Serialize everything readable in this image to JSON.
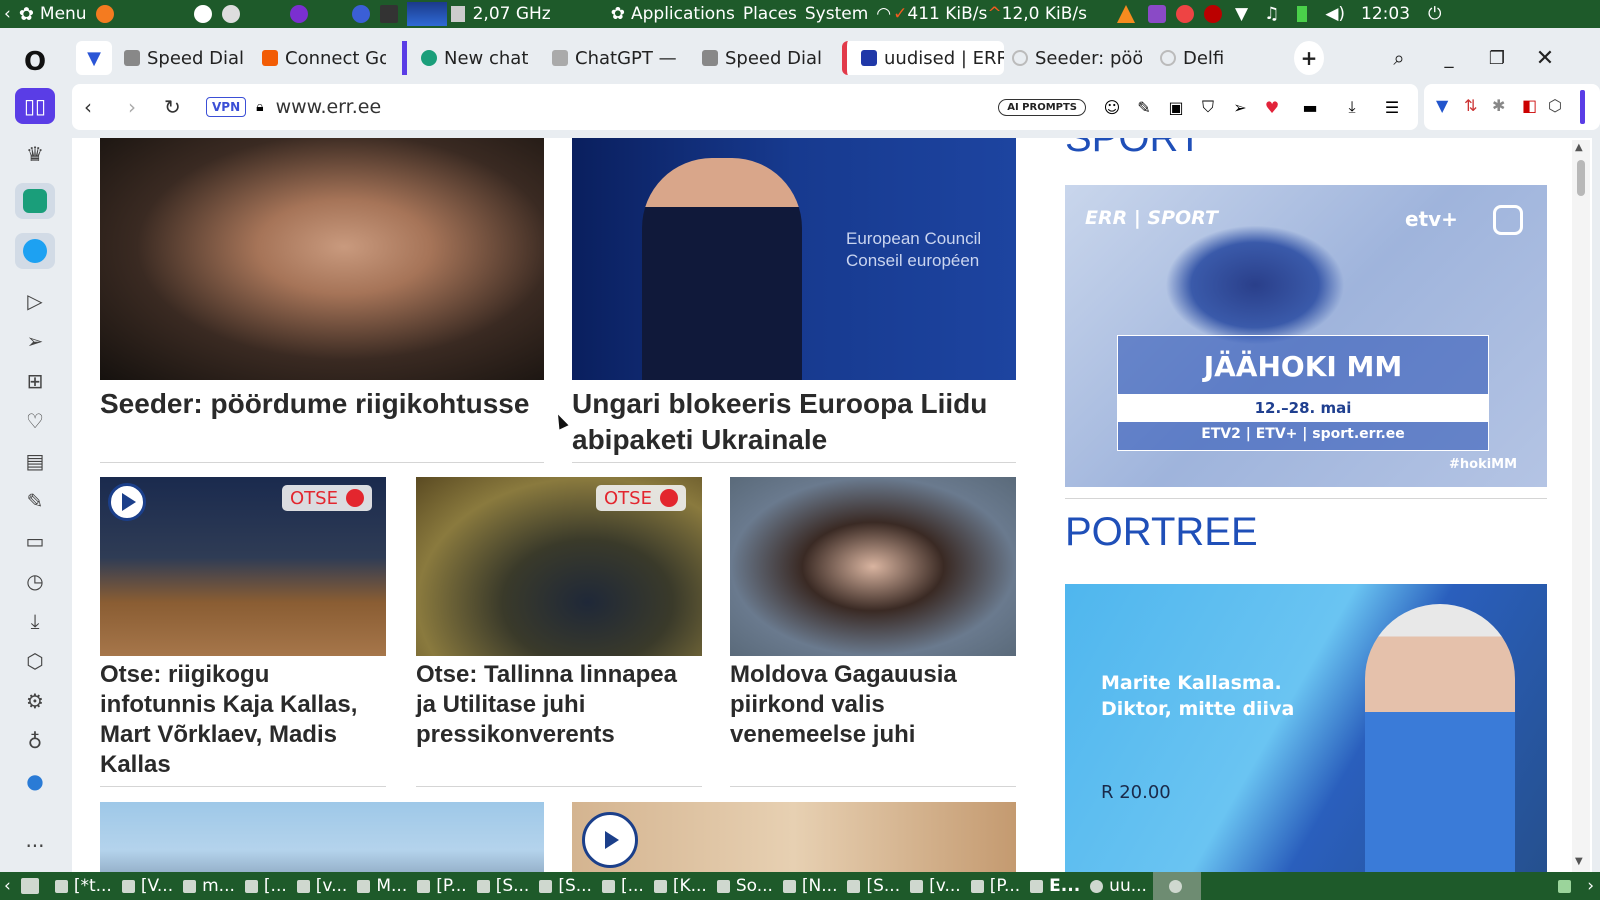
{
  "system_panel": {
    "menu_label": "Menu",
    "cpu_freq": "2,07 GHz",
    "applications_label": "Applications",
    "places_label": "Places",
    "system_label": "System",
    "net_down": "411 KiB/s",
    "net_up": "12,0 KiB/s",
    "clock": "12:03"
  },
  "tabs": [
    {
      "label": "Speed Dial",
      "icon": "speed-dial-icon"
    },
    {
      "label": "Connect Go",
      "icon": "connect-icon"
    },
    {
      "label": "New chat",
      "icon": "chatgpt-icon"
    },
    {
      "label": "ChatGPT —",
      "icon": "page-icon"
    },
    {
      "label": "Speed Dial",
      "icon": "speed-dial-icon"
    },
    {
      "label": "uudised | ERR",
      "icon": "err-icon"
    },
    {
      "label": "Seeder: pöö",
      "icon": "loading-icon"
    },
    {
      "label": "Delfi",
      "icon": "loading-icon"
    }
  ],
  "address_bar": {
    "vpn_label": "VPN",
    "url": "www.err.ee",
    "ai_prompts_label": "AI PROMPTS"
  },
  "articles": {
    "main_left": {
      "title": "Seeder: pöördume riigikohtusse"
    },
    "main_right": {
      "title": "Ungari blokeeris Euroopa Liidu abipaketi Ukrainale",
      "image_text": "European Council\nConseil européen"
    },
    "small": [
      {
        "title": "Otse: riigikogu infotunnis Kaja Kallas, Mart Võrklaev, Madis Kallas",
        "badge": "OTSE"
      },
      {
        "title": "Otse: Tallinna linnapea ja Utilitase juhi pressikonverents",
        "badge": "OTSE"
      },
      {
        "title": "Moldova Gagauusia piirkond valis venemeelse juhi"
      }
    ]
  },
  "side_column": {
    "sport_heading": "SPORT",
    "sport_ad": {
      "brand": "ERR | SPORT",
      "channel": "etv+",
      "title": "JÄÄHOKI MM",
      "dates": "12.–28. mai",
      "channels": "ETV2 | ETV+ | sport.err.ee",
      "hashtag": "#hokiMM"
    },
    "portree_heading": "PORTREE",
    "portree_ad": {
      "line1": "Marite Kallasma.",
      "line2": "Diktor, mitte diiva",
      "time": "R 20.00"
    }
  },
  "taskbar": [
    {
      "label": "[*t..."
    },
    {
      "label": "[V..."
    },
    {
      "label": "m..."
    },
    {
      "label": "[..."
    },
    {
      "label": "[v..."
    },
    {
      "label": "M..."
    },
    {
      "label": "[P..."
    },
    {
      "label": "[S..."
    },
    {
      "label": "[S..."
    },
    {
      "label": "[..."
    },
    {
      "label": "[K..."
    },
    {
      "label": "So..."
    },
    {
      "label": "[N..."
    },
    {
      "label": "[S..."
    },
    {
      "label": "[v..."
    },
    {
      "label": "[P..."
    },
    {
      "label": "E..."
    },
    {
      "label": "uu..."
    }
  ]
}
